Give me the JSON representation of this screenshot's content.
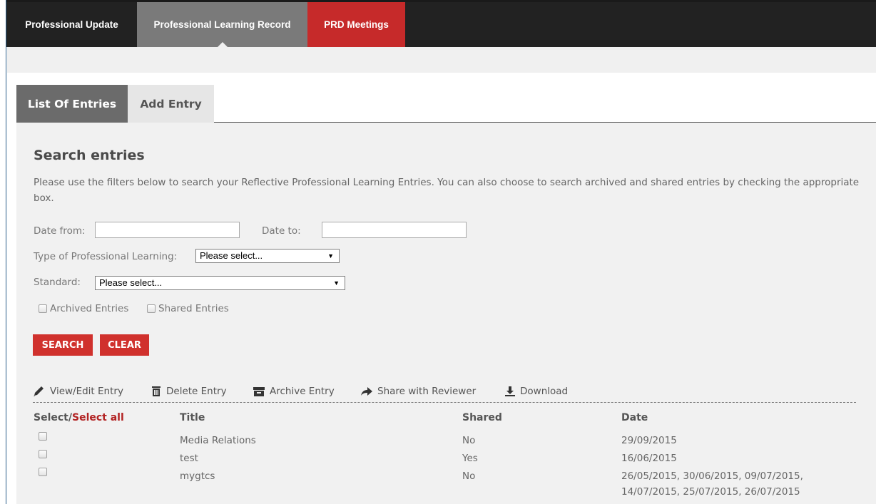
{
  "topnav": {
    "tabs": [
      {
        "label": "Professional Update"
      },
      {
        "label": "Professional Learning Record"
      },
      {
        "label": "PRD Meetings"
      }
    ]
  },
  "subtabs": {
    "list": "List Of Entries",
    "add": "Add Entry"
  },
  "search": {
    "heading": "Search entries",
    "intro": "Please use the filters below to search your Reflective Professional Learning Entries. You can also choose to search archived and shared entries by checking the appropriate box.",
    "date_from_label": "Date from:",
    "date_from_value": "",
    "date_to_label": "Date to:",
    "date_to_value": "",
    "type_label": "Type of Professional Learning:",
    "type_value": "Please select...",
    "standard_label": "Standard:",
    "standard_value": "Please select...",
    "archived_label": "Archived Entries",
    "shared_label": "Shared Entries",
    "search_button": "SEARCH",
    "clear_button": "CLEAR"
  },
  "toolbar": {
    "view_edit": "View/Edit Entry",
    "delete": "Delete Entry",
    "archive": "Archive Entry",
    "share": "Share with Reviewer",
    "download": "Download"
  },
  "table": {
    "col_select": "Select/",
    "col_select_all": "Select all",
    "col_title": "Title",
    "col_shared": "Shared",
    "col_date": "Date",
    "rows": [
      {
        "title": "Media Relations",
        "shared": "No",
        "date": "29/09/2015",
        "date2": ""
      },
      {
        "title": "test",
        "shared": "Yes",
        "date": "16/06/2015",
        "date2": ""
      },
      {
        "title": "mygtcs",
        "shared": "No",
        "date": "26/05/2015, 30/06/2015, 09/07/2015,",
        "date2": "14/07/2015, 25/07/2015, 26/07/2015"
      }
    ]
  },
  "colors": {
    "nav_bg": "#222222",
    "nav_active": "#7a7a7a",
    "nav_red": "#c62a2a",
    "button_red": "#d0312d",
    "select_all_red": "#b22222",
    "panel_bg": "#f1f1f1"
  }
}
